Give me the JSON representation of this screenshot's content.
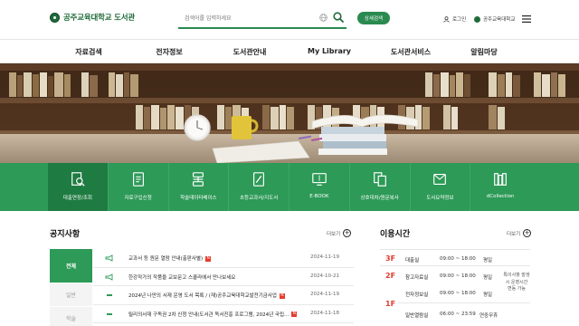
{
  "header": {
    "logo_text": "공주교육대학교 도서관",
    "search_placeholder": "검색어를 입력하세요",
    "detail_search_label": "상세검색",
    "login_label": "로그인",
    "univ_label": "공주교육대학교"
  },
  "nav": {
    "items": [
      "자료검색",
      "전자정보",
      "도서관안내",
      "My Library",
      "도서관서비스",
      "알림마당"
    ]
  },
  "quick_menu": {
    "items": [
      "대출연장/조회",
      "자료구입신청",
      "학술데이터베이스",
      "초등교과서/지도서",
      "E-BOOK",
      "상호대차/원문복사",
      "도서요약정보",
      "dCollection"
    ]
  },
  "notices": {
    "title": "공지사항",
    "more_label": "더보기",
    "tabs": [
      "전체",
      "일반",
      "학술"
    ],
    "items": [
      {
        "text": "교과서 등 원문 열람 안내(출판사별)",
        "date": "2024-11-19",
        "badge": "N",
        "icon": "megaphone-icon"
      },
      {
        "text": "한강작가의 작품을 교보문고 스콜라에서 만나보세요",
        "date": "2024-10-21",
        "badge": "",
        "icon": "megaphone-icon"
      },
      {
        "text": "2024년 나만의 서재 운영 도서 목록 / (재)공주교육대학교발전기금사업",
        "date": "2024-11-19",
        "badge": "N",
        "icon": "dash-icon"
      },
      {
        "text": "릴리의서재 구독권 2차 신청 안내(도서관 독서진흥 프로그램, 2024년 국립...",
        "date": "2024-11-18",
        "badge": "N",
        "icon": "dash-icon"
      }
    ]
  },
  "hours": {
    "title": "이용시간",
    "more_label": "더보기",
    "rows": [
      {
        "floor": "3F",
        "name": "대출실",
        "time": "09:00 ~ 18:00",
        "day": "평일"
      },
      {
        "floor": "2F",
        "name": "참고자료실",
        "time": "09:00 ~ 18:00",
        "day": "평일"
      },
      {
        "floor": "",
        "name": "전자정보실",
        "time": "09:00 ~ 18:00",
        "day": "평일"
      },
      {
        "floor": "1F",
        "name": "일반열람실",
        "time": "06:00 ~ 23:59",
        "day": "연중무휴"
      }
    ],
    "note": "특이사항 발생시 운영시간 변동 가능"
  },
  "colors": {
    "brand_green": "#2d9a57",
    "brand_dark_green": "#1e7b41",
    "accent_red": "#e23b2e"
  }
}
